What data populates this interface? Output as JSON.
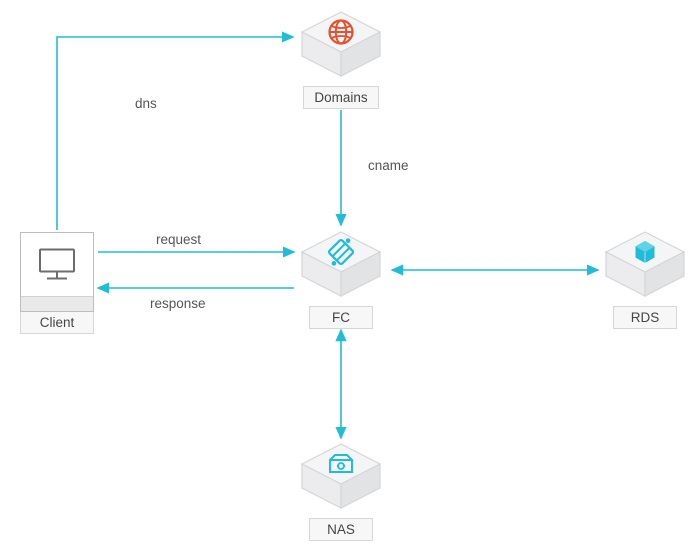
{
  "nodes": {
    "client": {
      "label": "Client"
    },
    "domains": {
      "label": "Domains"
    },
    "fc": {
      "label": "FC"
    },
    "rds": {
      "label": "RDS"
    },
    "nas": {
      "label": "NAS"
    }
  },
  "edges": {
    "dns": {
      "label": "dns"
    },
    "cname": {
      "label": "cname"
    },
    "request": {
      "label": "request"
    },
    "response": {
      "label": "response"
    }
  },
  "colors": {
    "arrow": "#20bcd8",
    "icon_cyan": "#20bcd8",
    "icon_orange": "#e94f2d",
    "cube_face": "#f4f5f6",
    "cube_stroke": "#d4d6d8"
  }
}
